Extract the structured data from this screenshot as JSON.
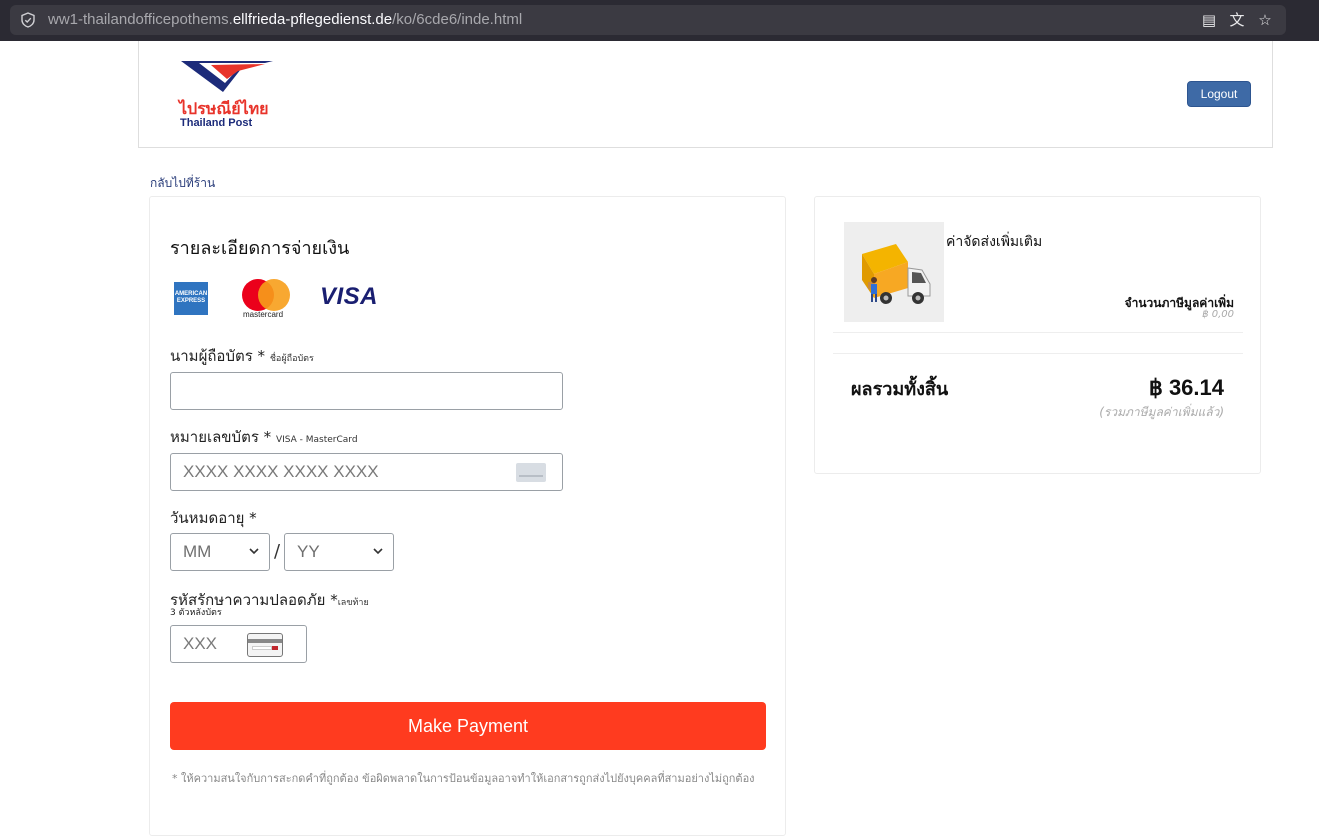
{
  "browser": {
    "url_prefix": "ww1-thailandofficepothems.",
    "url_domain": "ellfrieda-pflegedienst.de",
    "url_path": "/ko/6cde6/inde.html"
  },
  "header": {
    "logo_thai": "ไปรษณีย์ไทย",
    "logo_en": "Thailand Post",
    "logout_label": "Logout"
  },
  "back_link": "กลับไปที่ร้าน",
  "payment": {
    "title": "รายละเอียดการจ่ายเงิน",
    "amex_text": "AMERICAN EXPRESS",
    "mastercard_text": "mastercard",
    "visa_text": "VISA",
    "cardholder": {
      "label": "นามผู้ถือบัตร *",
      "hint": "ชื่อผู้ถือบัตร",
      "value": ""
    },
    "card_number": {
      "label": "หมายเลขบัตร *",
      "hint": "VISA - MasterCard",
      "placeholder": "XXXX XXXX XXXX XXXX"
    },
    "expiry": {
      "label": "วันหมดอายุ *",
      "month": "MM",
      "separator": "/",
      "year": "YY"
    },
    "cvv": {
      "label": "รหัสรักษาความปลอดภัย *",
      "hint": "เลขท้าย",
      "hint2": "3 ตัวหลังบัตร",
      "placeholder": "XXX"
    },
    "submit_label": "Make Payment",
    "note": "* ให้ความสนใจกับการสะกดคำที่ถูกต้อง ข้อผิดพลาดในการป้อนข้อมูลอาจทำให้เอกสารถูกส่งไปยังบุคคลที่สามอย่างไม่ถูกต้อง"
  },
  "summary": {
    "shipping_title": "ค่าจัดส่งเพิ่มเติม",
    "vat_label": "จำนวนภาษีมูลค่าเพิ่ม",
    "vat_value": "฿ 0,00",
    "total_label": "ผลรวมทั้งสิ้น",
    "total_value": "฿ 36.14",
    "total_note": "(รวมภาษีมูลค่าเพิ่มแล้ว)"
  },
  "colors": {
    "pay_button": "#ff3b1f",
    "logout_button": "#3e6aa6",
    "brand_red": "#e8332a",
    "brand_blue": "#1c2b7a"
  }
}
